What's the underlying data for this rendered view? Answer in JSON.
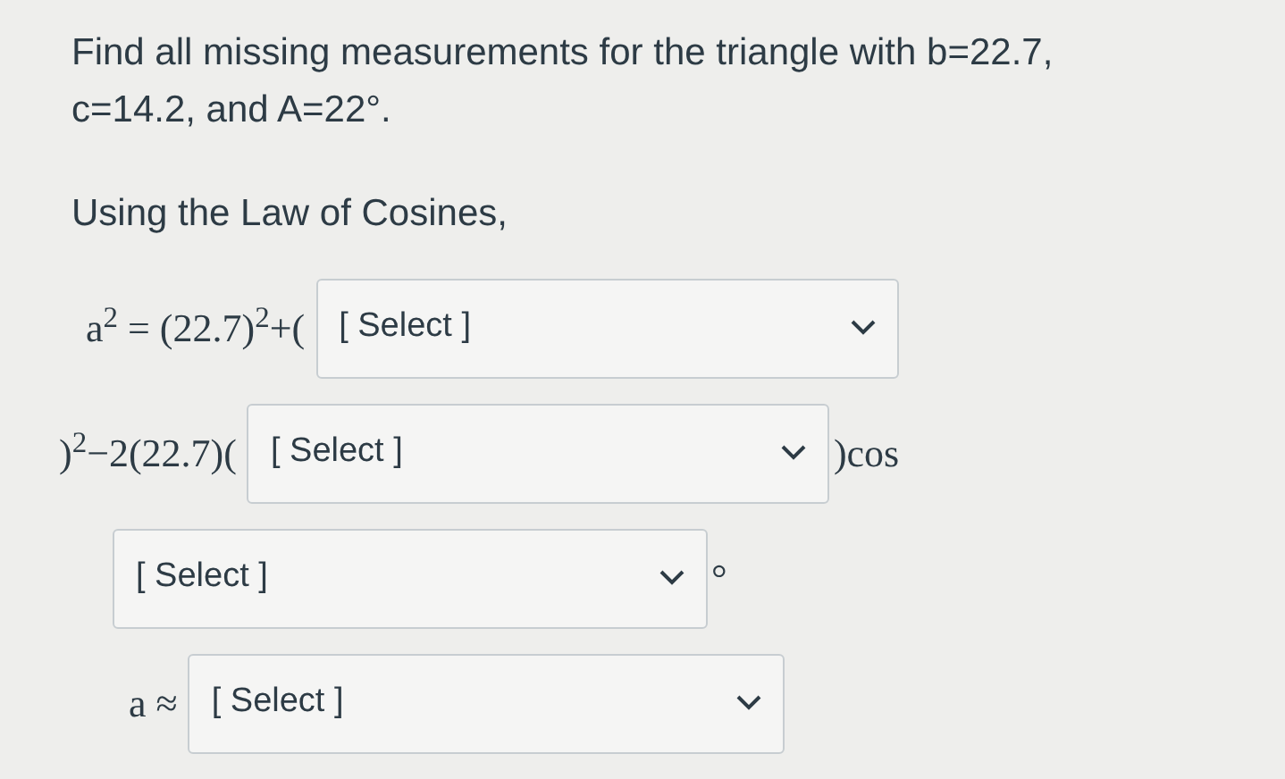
{
  "question": {
    "line_1": "Find all missing measurements for the triangle with b=22.7,",
    "line_2": "c=14.2, and A=22°."
  },
  "intro": "Using the Law of Cosines,",
  "equation": [
    {
      "before": "a$^{2}$ = (22.7)$^{2}$+(",
      "select": "[ Select ]"
    },
    {
      "before": ")$^{2}$−2(22.7)(",
      "select": "[ Select ]",
      "after": ")cos"
    },
    {
      "select": "[ Select ]",
      "after": "°"
    },
    {
      "before": "a ≈",
      "select": "[ Select ]"
    }
  ]
}
